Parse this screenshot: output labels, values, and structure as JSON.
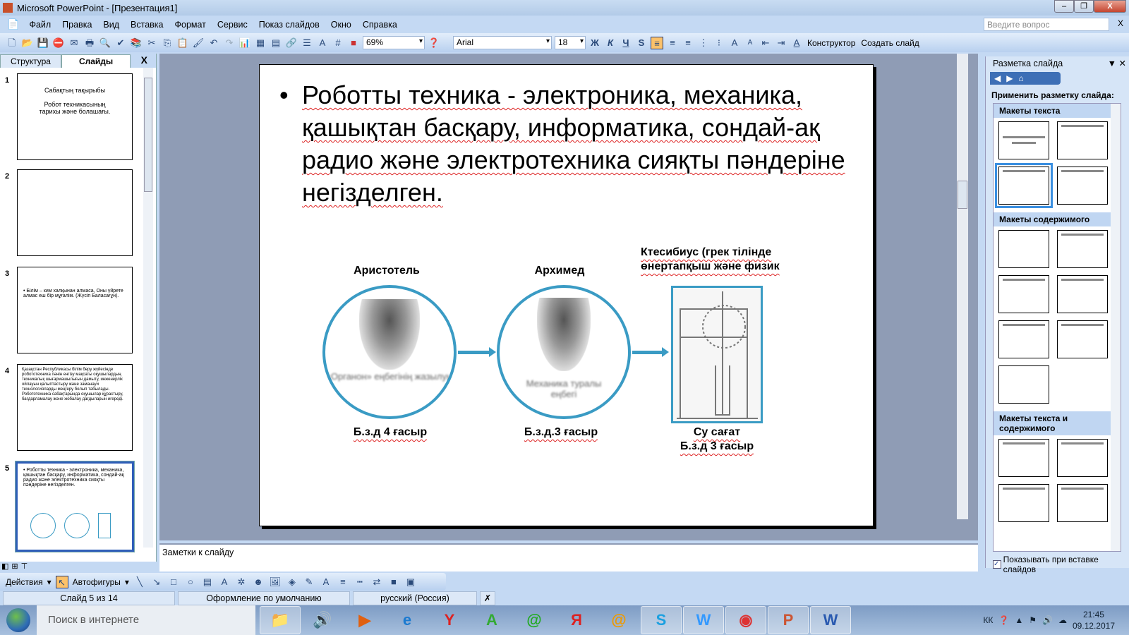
{
  "window": {
    "title": "Microsoft PowerPoint - [Презентация1]"
  },
  "menu": [
    "Файл",
    "Правка",
    "Вид",
    "Вставка",
    "Формат",
    "Сервис",
    "Показ слайдов",
    "Окно",
    "Справка"
  ],
  "ask_placeholder": "Введите вопрос",
  "toolbar": {
    "zoom": "69%",
    "font": "Arial",
    "size": "18",
    "bold": "Ж",
    "italic": "К",
    "underline": "Ч",
    "shadow": "S",
    "designer": "Конструктор",
    "new_slide": "Создать слайд"
  },
  "left_pane": {
    "tabs": [
      "Структура",
      "Слайды"
    ],
    "close": "X",
    "thumbs": [
      {
        "num": "1",
        "title": "Сабақтың тақырыбы",
        "text": "Робот техникасының тарихы және болашағы."
      },
      {
        "num": "2"
      },
      {
        "num": "3",
        "text": "• Білім – ким халқынан алмаса, Оны үйрете алмас еш бір мұғалім. (Жүсіп Баласағұн)."
      },
      {
        "num": "4",
        "text": "Қазақстан Республикасы білім беру жүйесінде робототехника пәнін енгізу мақсаты оқушылардың техникалық шығармашылығын дамыту, инженерлік ойлауын қалыптастыру және заманауи технологияларды меңгеру болып табылады. Робототехника сабақтарында оқушылар құрастыру, бағдарламалау және жобалау дағдыларын игереді."
      },
      {
        "num": "5",
        "text": "• Роботты техника - электроника, механика, қашықтан басқару, информатика, сондай-ақ радио және электротехника сияқты пәндеріне негізделген."
      }
    ]
  },
  "slide": {
    "bullet": "Роботты техника - электроника, механика, қашықтан басқару, информатика, сондай-ақ радио және электротехника сияқты пәндеріне негізделген.",
    "people": [
      {
        "name": "Аристотель",
        "caption": "«Органон» еңбегінің жазылуы",
        "date": "Б.з.д 4 ғасыр"
      },
      {
        "name": "Архимед",
        "caption": "Механика туралы еңбегі",
        "date": "Б.з.д.3 ғасыр"
      },
      {
        "name": "Ктесибиус (грек тілінде өнертапқыш және физик",
        "date_line1": "Су сағат",
        "date": "Б.з.д 3 ғасыр"
      }
    ],
    "accent": "#3a9bc4"
  },
  "notes_placeholder": "Заметки к слайду",
  "task_pane": {
    "title": "Разметка слайда",
    "apply": "Применить разметку слайда:",
    "groups": [
      "Макеты текста",
      "Макеты содержимого",
      "Макеты текста и содержимого"
    ],
    "show_on_insert": "Показывать при вставке слайдов"
  },
  "draw_toolbar": {
    "actions": "Действия",
    "autoshapes": "Автофигуры"
  },
  "status": {
    "slide": "Слайд 5 из 14",
    "design": "Оформление по умолчанию",
    "lang": "русский (Россия)"
  },
  "taskbar": {
    "search": "Поиск в интернете",
    "lang": "КК",
    "time": "21:45",
    "date": "09.12.2017"
  }
}
